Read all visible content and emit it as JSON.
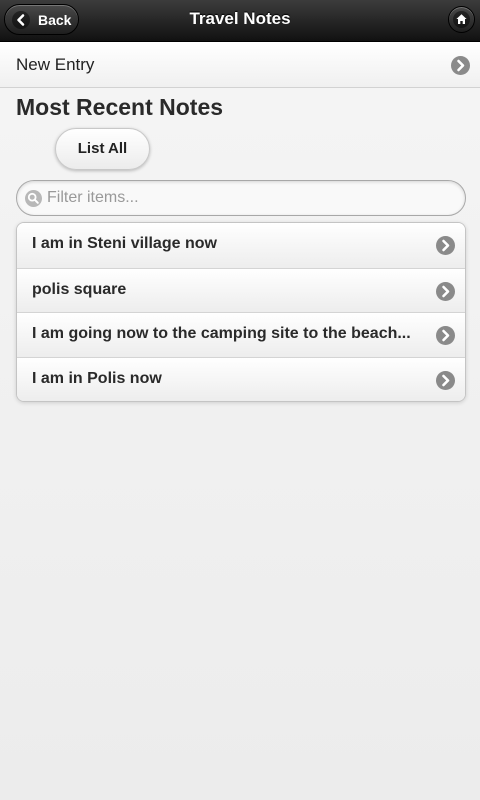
{
  "header": {
    "title": "Travel Notes",
    "back_label": "Back",
    "back_icon": "chevron-left-icon",
    "home_icon": "home-icon"
  },
  "new_entry": {
    "label": "New Entry",
    "icon": "chevron-right-icon"
  },
  "section": {
    "title": "Most Recent Notes"
  },
  "list_all_button": {
    "label": "List All"
  },
  "filter": {
    "placeholder": "Filter items...",
    "value": "",
    "icon": "search-icon"
  },
  "notes": [
    {
      "label": "I am in Steni village now"
    },
    {
      "label": "polis square"
    },
    {
      "label": "I am going now to the camping site to the beach..."
    },
    {
      "label": "I am in Polis now"
    }
  ],
  "colors": {
    "header_bg": "#111111",
    "page_bg": "#f2f2f2",
    "arrow_icon_bg": "#8a8a8a"
  }
}
